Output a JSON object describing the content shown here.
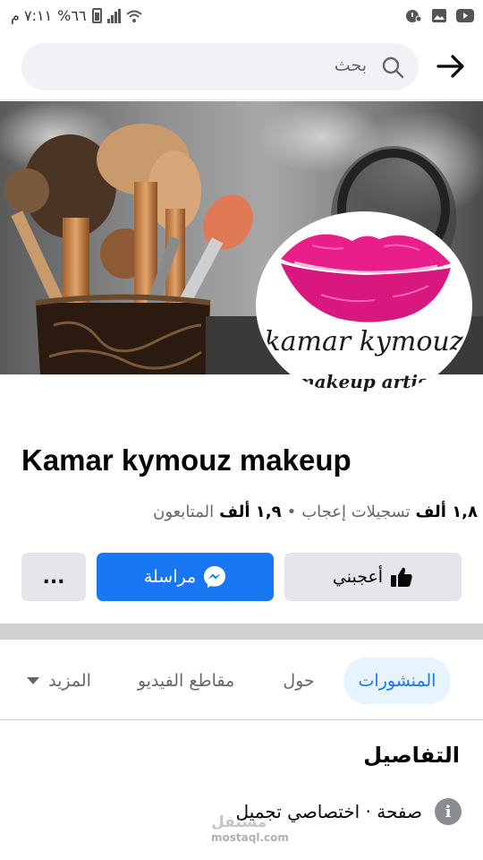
{
  "status_bar": {
    "time": "٧:١١ م",
    "battery": "%٦٦"
  },
  "header": {
    "search_placeholder": "بحث",
    "icons": [
      "arrow-right-icon",
      "search-icon"
    ]
  },
  "cover": {
    "logo_script": "kamar kymouz",
    "logo_tagline": "makeup artist",
    "colors": {
      "lips": "#e81e8a",
      "logo_text": "#1a1a1a"
    }
  },
  "page": {
    "name": "Kamar kymouz makeup",
    "likes_value": "١,٨ ألف",
    "likes_label": "تسجيلات إعجاب",
    "separator": "•",
    "followers_value": "١,٩ ألف",
    "followers_label": "المتابعون"
  },
  "actions": {
    "like_label": "أعجبني",
    "message_label": "مراسلة",
    "more_label": "..."
  },
  "tabs": {
    "posts": "المنشورات",
    "about": "حول",
    "videos": "مقاطع الفيديو",
    "more": "المزيد"
  },
  "details": {
    "title": "التفاصيل",
    "category": "صفحة · اختصاصي تجميل"
  },
  "watermark": {
    "brand": "مستقل",
    "domain": "mostaql.com"
  },
  "colors": {
    "accent": "#1877f2",
    "active_tab_bg": "#e7f3ff",
    "button_grey": "#e4e6eb",
    "divider": "#ced0d4"
  }
}
